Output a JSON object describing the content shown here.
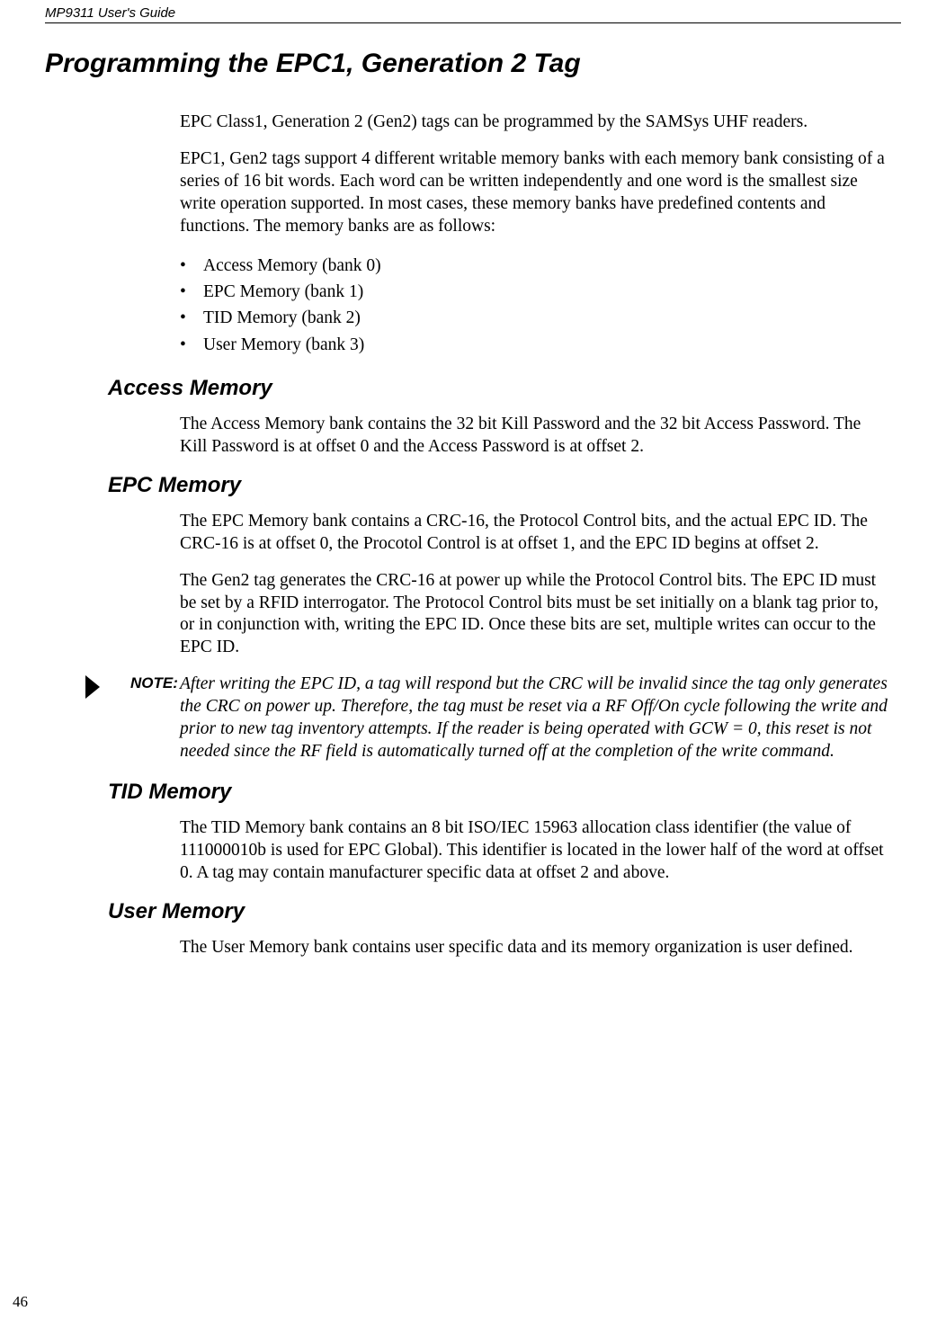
{
  "header": "MP9311 User's Guide",
  "title": "Programming the EPC1, Generation 2 Tag",
  "intro1": "EPC Class1, Generation 2 (Gen2) tags can be programmed by the SAMSys UHF readers.",
  "intro2": "EPC1, Gen2 tags support 4 different writable memory banks with each memory bank consisting of a series of 16 bit words. Each word can be written independently and one word is the smallest size write operation supported. In most cases, these memory banks have predefined contents and functions. The memory banks are as follows:",
  "bullets": {
    "b0": "Access Memory (bank 0)",
    "b1": "EPC Memory (bank 1)",
    "b2": "TID Memory (bank 2)",
    "b3": "User Memory (bank 3)"
  },
  "sections": {
    "access": {
      "heading": "Access Memory",
      "p1": "The Access Memory bank contains the 32 bit Kill Password and the 32 bit Access Password.  The Kill Password is at offset 0 and the Access Password is at offset 2."
    },
    "epc": {
      "heading": "EPC Memory",
      "p1": "The EPC Memory bank contains a CRC-16, the Protocol Control bits, and the actual EPC ID.  The CRC-16 is at offset 0, the Procotol Control is at offset 1, and the EPC ID begins at offset 2.",
      "p2": "The Gen2 tag generates the CRC-16 at power up while the Protocol Control bits. The EPC ID must be set by a RFID interrogator.  The Protocol Control bits must be set initially on a blank tag prior to, or in conjunction with, writing the EPC ID.  Once these bits are set, multiple writes can occur to the EPC ID.",
      "note_label": "NOTE:",
      "note": "After writing the EPC ID, a tag will respond but the CRC will be invalid since the tag only generates the CRC on power up.  Therefore, the tag must be reset via a RF Off/On cycle following the write and prior to new tag inventory attempts.  If the reader is being operated with GCW = 0, this reset is not needed since the RF field is automatically turned off at the completion of the write command."
    },
    "tid": {
      "heading": "TID Memory",
      "p1": "The TID Memory bank contains an 8 bit ISO/IEC 15963 allocation class identifier (the value of 111000010b is used for EPC Global). This identifier is located in the lower half of the word at offset 0.  A tag may contain manufacturer specific data at offset 2 and above."
    },
    "user": {
      "heading": "User Memory",
      "p1": "The User Memory bank contains user specific data and its memory organization is user defined."
    }
  },
  "pageNumber": "46"
}
